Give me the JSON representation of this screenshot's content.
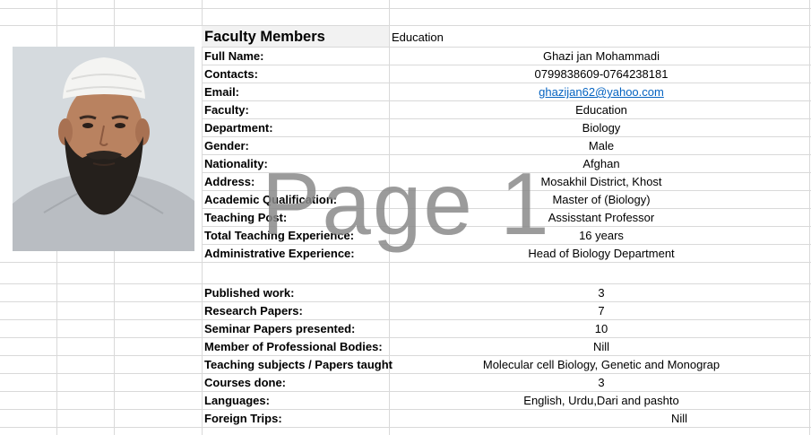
{
  "header": {
    "title": "Faculty Members",
    "value": "Education"
  },
  "profile": {
    "rows": [
      {
        "label": "Full Name:",
        "value": "Ghazi jan Mohammadi"
      },
      {
        "label": "Contacts:",
        "value": "0799838609-0764238181"
      },
      {
        "label": "Email:",
        "value": "ghazijan62@yahoo.com",
        "link": true
      },
      {
        "label": "Faculty:",
        "value": "Education"
      },
      {
        "label": "Department:",
        "value": "Biology"
      },
      {
        "label": "Gender:",
        "value": "Male"
      },
      {
        "label": "Nationality:",
        "value": "Afghan"
      },
      {
        "label": "Address:",
        "value": "Mosakhil District, Khost"
      },
      {
        "label": "Academic Qualification:",
        "value": "Master of  (Biology)"
      },
      {
        "label": "Teaching Post:",
        "value": "Assisstant Professor"
      },
      {
        "label": "Total Teaching Experience:",
        "value": "16 years"
      },
      {
        "label": "Administrative Experience:",
        "value": "Head of Biology Department"
      }
    ]
  },
  "work": {
    "rows": [
      {
        "label": "Published work:",
        "value": "3"
      },
      {
        "label": "Research Papers:",
        "value": "7"
      },
      {
        "label": "Seminar Papers presented:",
        "value": "10"
      },
      {
        "label": "Member of Professional Bodies:",
        "value": "Nill"
      },
      {
        "label": "Teaching subjects / Papers taught",
        "value": "Molecular cell Biology, Genetic and Monograp"
      },
      {
        "label": "Courses done:",
        "value": "3"
      },
      {
        "label": "Languages:",
        "value": "English, Urdu,Dari and pashto"
      },
      {
        "label": "Foreign Trips:",
        "value": "Nill",
        "offset": true
      }
    ]
  },
  "watermark": "Page 1",
  "colors": {
    "gridline": "#d9d9d9",
    "link": "#0563c1",
    "header_fill": "#f2f2f2",
    "watermark": "#8a8a8a"
  }
}
